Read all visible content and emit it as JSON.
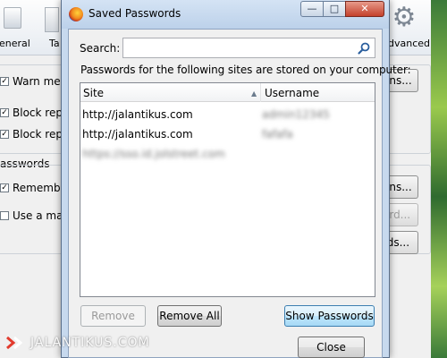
{
  "background_window": {
    "tabs": [
      {
        "label": "eneral"
      },
      {
        "label": "Ta"
      },
      {
        "label": "dvanced"
      }
    ],
    "options": [
      {
        "label": "Warn me v",
        "checked": true
      },
      {
        "label": "Block repo",
        "checked": true
      },
      {
        "label": "Block repo",
        "checked": true
      }
    ],
    "passwords_section_label": "asswords",
    "password_options": [
      {
        "label": "Remember",
        "checked": true
      },
      {
        "label": "Use a mast",
        "checked": false
      }
    ],
    "buttons": [
      {
        "label": "ons...",
        "enabled": true
      },
      {
        "label": "ons...",
        "enabled": true
      },
      {
        "label": "ord...",
        "enabled": false
      },
      {
        "label": "rds...",
        "enabled": true
      }
    ]
  },
  "dialog": {
    "title": "Saved Passwords",
    "window_controls": {
      "minimize": "—",
      "maximize": "□",
      "close": "✕"
    },
    "search": {
      "label": "Search:",
      "value": "",
      "placeholder": ""
    },
    "info_text": "Passwords for the following sites are stored on your computer:",
    "columns": {
      "site": "Site",
      "username": "Username",
      "sort": "▲"
    },
    "rows": [
      {
        "site": "http://jalantikus.com",
        "username": "admin12345",
        "blurred_site": false
      },
      {
        "site": "http://jalantikus.com",
        "username": "fafafa",
        "blurred_site": false
      },
      {
        "site": "https://sso.id.jolstreet.com",
        "username": "",
        "blurred_site": true
      }
    ],
    "buttons": {
      "remove": "Remove",
      "remove_all": "Remove All",
      "show_passwords": "Show Passwords",
      "close": "Close"
    }
  },
  "watermark": {
    "text": "JALANTIKUS.COM"
  }
}
